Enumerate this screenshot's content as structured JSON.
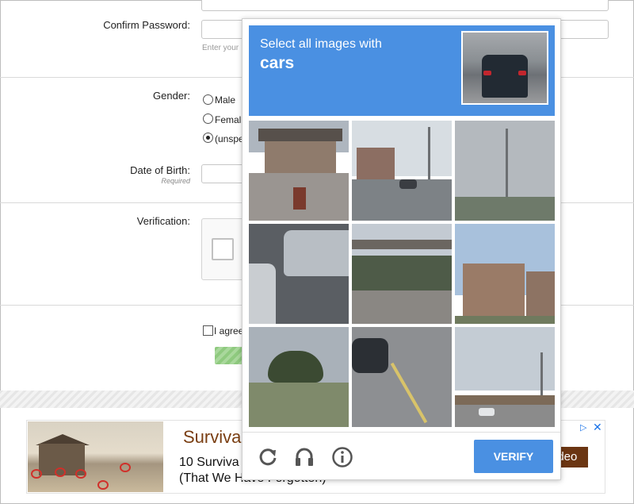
{
  "form": {
    "confirm_password_label": "Confirm Password:",
    "password_hint": "Enter your",
    "gender_label": "Gender:",
    "gender_options": [
      "Male",
      "Femal",
      "(unspe"
    ],
    "dob_label": "Date of Birth:",
    "dob_required": "Required",
    "verification_label": "Verification:",
    "agree_label": "I agree"
  },
  "ad": {
    "title": "Surviva",
    "line1": "10 Surviva",
    "line2": "(That We Have Forgotten)",
    "video_button": "ideo",
    "play_icon": "▷",
    "close_icon": "✕"
  },
  "captcha": {
    "instruction": "Select all images with",
    "target": "cars",
    "verify_label": "VERIFY",
    "icons": [
      "reload-icon",
      "audio-icon",
      "info-icon"
    ]
  },
  "colors": {
    "captcha_blue": "#4a90e2",
    "ad_brown": "#7a3e12"
  }
}
